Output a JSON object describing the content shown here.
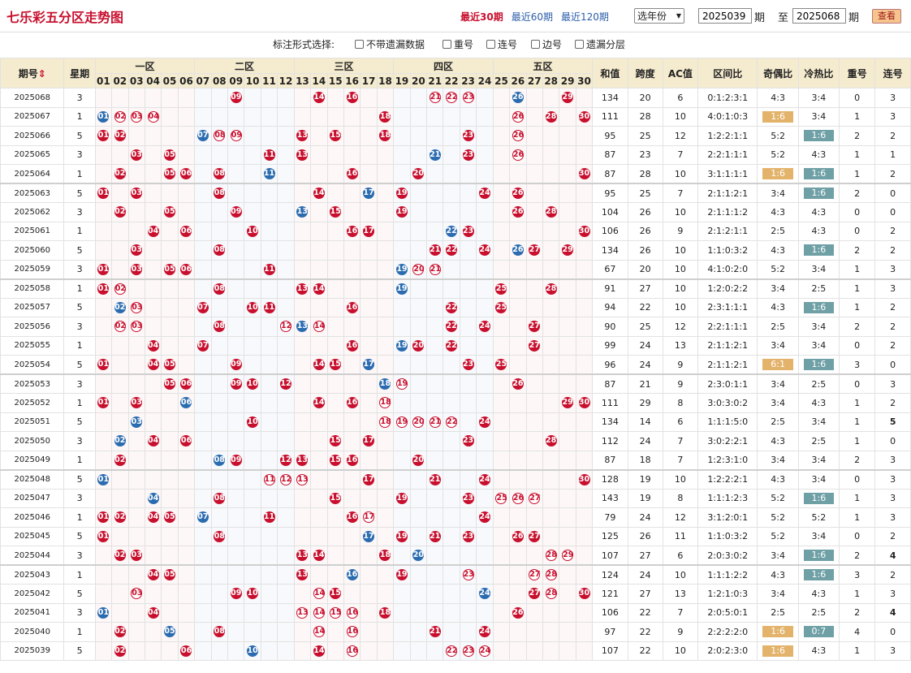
{
  "title": "七乐彩五分区走势图",
  "period_links": [
    {
      "label": "最近30期",
      "active": true
    },
    {
      "label": "最近60期",
      "active": false
    },
    {
      "label": "最近120期",
      "active": false
    }
  ],
  "year_select": "选年份",
  "range": {
    "from": "2025039",
    "to": "2025068",
    "issue_unit": "期",
    "to_label": "至"
  },
  "view_button": "查看",
  "annotation": {
    "label": "标注形式选择:",
    "options": [
      "不带遗漏数据",
      "重号",
      "连号",
      "边号",
      "遗漏分层"
    ]
  },
  "columns": {
    "issue": "期号",
    "weekday": "星期",
    "zones": [
      "一区",
      "二区",
      "三区",
      "四区",
      "五区"
    ],
    "numbers": [
      "01",
      "02",
      "03",
      "04",
      "05",
      "06",
      "07",
      "08",
      "09",
      "10",
      "11",
      "12",
      "13",
      "14",
      "15",
      "16",
      "17",
      "18",
      "19",
      "20",
      "21",
      "22",
      "23",
      "24",
      "25",
      "26",
      "27",
      "28",
      "29",
      "30"
    ],
    "stats": [
      "和值",
      "跨度",
      "AC值",
      "区间比",
      "奇偶比",
      "冷热比",
      "重号",
      "连号"
    ]
  },
  "rows": [
    {
      "issue": "2025068",
      "wd": "3",
      "balls": [
        9,
        14,
        16,
        21,
        22,
        23,
        26,
        29
      ],
      "blue": [
        26
      ],
      "ring": [
        21,
        22,
        23
      ],
      "sum": "134",
      "span": "20",
      "ac": "6",
      "zone": "0:1:2:3:1",
      "oe": "4:3",
      "ch": "3:4",
      "rep": "0",
      "con": "3",
      "oe_hl": "",
      "ch_hl": "",
      "rep_red": false,
      "con_green": false
    },
    {
      "issue": "2025067",
      "wd": "1",
      "balls": [
        1,
        2,
        3,
        4,
        18,
        26,
        28,
        30
      ],
      "blue": [
        1
      ],
      "ring": [
        2,
        3,
        4,
        26
      ],
      "sum": "111",
      "span": "28",
      "ac": "10",
      "zone": "4:0:1:0:3",
      "oe": "1:6",
      "ch": "3:4",
      "rep": "1",
      "con": "3",
      "oe_hl": "orange",
      "ch_hl": "",
      "rep_red": false,
      "con_green": false
    },
    {
      "issue": "2025066",
      "wd": "5",
      "balls": [
        1,
        2,
        7,
        8,
        9,
        13,
        15,
        18,
        23,
        26
      ],
      "blue": [
        7
      ],
      "ring": [
        8,
        9,
        26
      ],
      "sum": "95",
      "span": "25",
      "ac": "12",
      "zone": "1:2:2:1:1",
      "oe": "5:2",
      "ch": "1:6",
      "rep": "2",
      "con": "2",
      "oe_hl": "",
      "ch_hl": "teal",
      "rep_red": false,
      "con_green": false
    },
    {
      "issue": "2025065",
      "wd": "3",
      "balls": [
        3,
        5,
        11,
        13,
        21,
        23,
        26
      ],
      "blue": [
        21
      ],
      "ring": [
        26
      ],
      "sum": "87",
      "span": "23",
      "ac": "7",
      "zone": "2:2:1:1:1",
      "oe": "5:2",
      "ch": "4:3",
      "rep": "1",
      "con": "1",
      "oe_hl": "",
      "ch_hl": "",
      "rep_red": false,
      "con_green": false
    },
    {
      "issue": "2025064",
      "wd": "1",
      "balls": [
        2,
        5,
        6,
        8,
        11,
        16,
        20,
        30
      ],
      "blue": [
        11
      ],
      "ring": [],
      "sum": "87",
      "span": "28",
      "ac": "10",
      "zone": "3:1:1:1:1",
      "oe": "1:6",
      "ch": "1:6",
      "rep": "1",
      "con": "2",
      "oe_hl": "orange",
      "ch_hl": "teal",
      "rep_red": false,
      "con_green": false
    },
    {
      "issue": "2025063",
      "wd": "5",
      "balls": [
        1,
        3,
        8,
        14,
        17,
        19,
        24,
        26
      ],
      "blue": [
        17
      ],
      "ring": [],
      "sum": "95",
      "span": "25",
      "ac": "7",
      "zone": "2:1:1:2:1",
      "oe": "3:4",
      "ch": "1:6",
      "rep": "2",
      "con": "0",
      "oe_hl": "",
      "ch_hl": "teal",
      "rep_red": false,
      "con_green": false
    },
    {
      "issue": "2025062",
      "wd": "3",
      "balls": [
        2,
        5,
        9,
        13,
        15,
        19,
        26,
        28
      ],
      "blue": [
        13
      ],
      "ring": [],
      "sum": "104",
      "span": "26",
      "ac": "10",
      "zone": "2:1:1:1:2",
      "oe": "4:3",
      "ch": "4:3",
      "rep": "0",
      "con": "0",
      "oe_hl": "",
      "ch_hl": "",
      "rep_red": false,
      "con_green": false
    },
    {
      "issue": "2025061",
      "wd": "1",
      "balls": [
        4,
        6,
        10,
        16,
        17,
        22,
        23,
        30
      ],
      "blue": [
        22
      ],
      "ring": [],
      "sum": "106",
      "span": "26",
      "ac": "9",
      "zone": "2:1:2:1:1",
      "oe": "2:5",
      "ch": "4:3",
      "rep": "0",
      "con": "2",
      "oe_hl": "",
      "ch_hl": "",
      "rep_red": false,
      "con_green": false
    },
    {
      "issue": "2025060",
      "wd": "5",
      "balls": [
        3,
        8,
        21,
        22,
        24,
        26,
        27,
        29
      ],
      "blue": [
        26
      ],
      "ring": [],
      "sum": "134",
      "span": "26",
      "ac": "10",
      "zone": "1:1:0:3:2",
      "oe": "4:3",
      "ch": "1:6",
      "rep": "2",
      "con": "2",
      "oe_hl": "",
      "ch_hl": "teal",
      "rep_red": false,
      "con_green": false
    },
    {
      "issue": "2025059",
      "wd": "3",
      "balls": [
        1,
        3,
        5,
        6,
        11,
        19,
        20,
        21
      ],
      "blue": [
        19
      ],
      "ring": [
        20,
        21
      ],
      "sum": "67",
      "span": "20",
      "ac": "10",
      "zone": "4:1:0:2:0",
      "oe": "5:2",
      "ch": "3:4",
      "rep": "1",
      "con": "3",
      "oe_hl": "",
      "ch_hl": "",
      "rep_red": false,
      "con_green": false
    },
    {
      "issue": "2025058",
      "wd": "1",
      "balls": [
        1,
        2,
        8,
        13,
        14,
        19,
        25,
        28
      ],
      "blue": [
        19
      ],
      "ring": [
        2
      ],
      "sum": "91",
      "span": "27",
      "ac": "10",
      "zone": "1:2:0:2:2",
      "oe": "3:4",
      "ch": "2:5",
      "rep": "1",
      "con": "3",
      "oe_hl": "",
      "ch_hl": "",
      "rep_red": false,
      "con_green": false
    },
    {
      "issue": "2025057",
      "wd": "5",
      "balls": [
        2,
        3,
        7,
        10,
        11,
        16,
        22,
        25
      ],
      "blue": [
        2
      ],
      "ring": [
        3
      ],
      "sum": "94",
      "span": "22",
      "ac": "10",
      "zone": "2:3:1:1:1",
      "oe": "4:3",
      "ch": "1:6",
      "rep": "1",
      "con": "2",
      "oe_hl": "",
      "ch_hl": "teal",
      "rep_red": false,
      "con_green": false
    },
    {
      "issue": "2025056",
      "wd": "3",
      "balls": [
        2,
        3,
        8,
        12,
        13,
        14,
        22,
        24,
        27
      ],
      "blue": [
        13
      ],
      "ring": [
        2,
        3,
        12,
        14
      ],
      "sum": "90",
      "span": "25",
      "ac": "12",
      "zone": "2:2:1:1:1",
      "oe": "2:5",
      "ch": "3:4",
      "rep": "2",
      "con": "2",
      "oe_hl": "",
      "ch_hl": "",
      "rep_red": false,
      "con_green": false
    },
    {
      "issue": "2025055",
      "wd": "1",
      "balls": [
        4,
        7,
        16,
        19,
        20,
        22,
        27
      ],
      "blue": [
        19
      ],
      "ring": [
        3
      ],
      "sum": "99",
      "span": "24",
      "ac": "13",
      "zone": "2:1:1:2:1",
      "oe": "3:4",
      "ch": "3:4",
      "rep": "0",
      "con": "2",
      "oe_hl": "",
      "ch_hl": "",
      "rep_red": false,
      "con_green": false
    },
    {
      "issue": "2025054",
      "wd": "5",
      "balls": [
        1,
        4,
        5,
        9,
        14,
        15,
        17,
        23,
        25
      ],
      "blue": [
        17
      ],
      "ring": [
        19
      ],
      "sum": "96",
      "span": "24",
      "ac": "9",
      "zone": "2:1:1:2:1",
      "oe": "6:1",
      "ch": "1:6",
      "rep": "3",
      "con": "0",
      "oe_hl": "orange",
      "ch_hl": "teal",
      "rep_red": false,
      "con_green": false
    },
    {
      "issue": "2025053",
      "wd": "3",
      "balls": [
        5,
        6,
        9,
        10,
        12,
        18,
        19,
        26
      ],
      "blue": [
        18
      ],
      "ring": [
        19
      ],
      "sum": "87",
      "span": "21",
      "ac": "9",
      "zone": "2:3:0:1:1",
      "oe": "3:4",
      "ch": "2:5",
      "rep": "0",
      "con": "3",
      "oe_hl": "",
      "ch_hl": "",
      "rep_red": false,
      "con_green": false
    },
    {
      "issue": "2025052",
      "wd": "1",
      "balls": [
        1,
        3,
        6,
        14,
        16,
        18,
        29,
        30
      ],
      "blue": [
        6
      ],
      "ring": [
        18
      ],
      "sum": "111",
      "span": "29",
      "ac": "8",
      "zone": "3:0:3:0:2",
      "oe": "3:4",
      "ch": "4:3",
      "rep": "1",
      "con": "2",
      "oe_hl": "",
      "ch_hl": "",
      "rep_red": false,
      "con_green": false
    },
    {
      "issue": "2025051",
      "wd": "5",
      "balls": [
        3,
        10,
        18,
        19,
        20,
        21,
        22,
        24
      ],
      "blue": [
        3
      ],
      "ring": [
        18,
        19,
        20,
        21,
        22
      ],
      "sum": "134",
      "span": "14",
      "ac": "6",
      "zone": "1:1:1:5:0",
      "oe": "2:5",
      "ch": "3:4",
      "rep": "1",
      "con": "5",
      "oe_hl": "",
      "ch_hl": "",
      "rep_red": false,
      "con_green": true
    },
    {
      "issue": "2025050",
      "wd": "3",
      "balls": [
        2,
        4,
        6,
        15,
        17,
        23,
        28
      ],
      "blue": [
        2
      ],
      "ring": [],
      "sum": "112",
      "span": "24",
      "ac": "7",
      "zone": "3:0:2:2:1",
      "oe": "4:3",
      "ch": "2:5",
      "rep": "1",
      "con": "0",
      "oe_hl": "",
      "ch_hl": "",
      "rep_red": false,
      "con_green": false
    },
    {
      "issue": "2025049",
      "wd": "1",
      "balls": [
        2,
        8,
        9,
        12,
        13,
        15,
        16,
        20
      ],
      "blue": [
        8
      ],
      "ring": [],
      "sum": "87",
      "span": "18",
      "ac": "7",
      "zone": "1:2:3:1:0",
      "oe": "3:4",
      "ch": "3:4",
      "rep": "2",
      "con": "3",
      "oe_hl": "",
      "ch_hl": "",
      "rep_red": false,
      "con_green": false
    },
    {
      "issue": "2025048",
      "wd": "5",
      "balls": [
        1,
        11,
        12,
        13,
        17,
        21,
        24,
        30
      ],
      "blue": [
        1
      ],
      "ring": [
        11,
        12,
        13
      ],
      "sum": "128",
      "span": "19",
      "ac": "10",
      "zone": "1:2:2:2:1",
      "oe": "4:3",
      "ch": "3:4",
      "rep": "0",
      "con": "3",
      "oe_hl": "",
      "ch_hl": "",
      "rep_red": false,
      "con_green": false
    },
    {
      "issue": "2025047",
      "wd": "3",
      "balls": [
        4,
        8,
        15,
        19,
        23,
        25,
        26,
        27
      ],
      "blue": [
        4
      ],
      "ring": [
        25,
        26,
        27
      ],
      "sum": "143",
      "span": "19",
      "ac": "8",
      "zone": "1:1:1:2:3",
      "oe": "5:2",
      "ch": "1:6",
      "rep": "1",
      "con": "3",
      "oe_hl": "",
      "ch_hl": "teal",
      "rep_red": false,
      "con_green": false
    },
    {
      "issue": "2025046",
      "wd": "1",
      "balls": [
        1,
        2,
        4,
        5,
        7,
        11,
        16,
        17,
        24
      ],
      "blue": [
        7
      ],
      "ring": [
        17
      ],
      "sum": "79",
      "span": "24",
      "ac": "12",
      "zone": "3:1:2:0:1",
      "oe": "5:2",
      "ch": "5:2",
      "rep": "1",
      "con": "3",
      "oe_hl": "",
      "ch_hl": "",
      "rep_red": false,
      "con_green": false
    },
    {
      "issue": "2025045",
      "wd": "5",
      "balls": [
        1,
        8,
        17,
        19,
        21,
        23,
        26,
        27
      ],
      "blue": [
        17
      ],
      "ring": [],
      "sum": "125",
      "span": "26",
      "ac": "11",
      "zone": "1:1:0:3:2",
      "oe": "5:2",
      "ch": "3:4",
      "rep": "0",
      "con": "2",
      "oe_hl": "",
      "ch_hl": "",
      "rep_red": false,
      "con_green": false
    },
    {
      "issue": "2025044",
      "wd": "3",
      "balls": [
        2,
        3,
        13,
        14,
        18,
        20,
        28,
        29
      ],
      "blue": [
        20
      ],
      "ring": [
        28,
        29
      ],
      "sum": "107",
      "span": "27",
      "ac": "6",
      "zone": "2:0:3:0:2",
      "oe": "3:4",
      "ch": "1:6",
      "rep": "2",
      "con": "4",
      "oe_hl": "",
      "ch_hl": "teal",
      "rep_red": false,
      "con_green": true
    },
    {
      "issue": "2025043",
      "wd": "1",
      "balls": [
        4,
        5,
        13,
        16,
        19,
        23,
        27,
        28
      ],
      "blue": [
        16
      ],
      "ring": [
        23,
        27,
        28
      ],
      "sum": "124",
      "span": "24",
      "ac": "10",
      "zone": "1:1:1:2:2",
      "oe": "4:3",
      "ch": "1:6",
      "rep": "3",
      "con": "2",
      "oe_hl": "",
      "ch_hl": "teal",
      "rep_red": false,
      "con_green": false
    },
    {
      "issue": "2025042",
      "wd": "5",
      "balls": [
        3,
        9,
        10,
        14,
        15,
        24,
        27,
        28,
        30
      ],
      "blue": [
        24
      ],
      "ring": [
        3,
        14,
        28
      ],
      "sum": "121",
      "span": "27",
      "ac": "13",
      "zone": "1:2:1:0:3",
      "oe": "3:4",
      "ch": "4:3",
      "rep": "1",
      "con": "3",
      "oe_hl": "",
      "ch_hl": "",
      "rep_red": false,
      "con_green": false
    },
    {
      "issue": "2025041",
      "wd": "3",
      "balls": [
        1,
        4,
        13,
        14,
        15,
        16,
        18,
        26
      ],
      "blue": [
        1
      ],
      "ring": [
        13,
        14,
        15,
        16
      ],
      "sum": "106",
      "span": "22",
      "ac": "7",
      "zone": "2:0:5:0:1",
      "oe": "2:5",
      "ch": "2:5",
      "rep": "2",
      "con": "4",
      "oe_hl": "",
      "ch_hl": "",
      "rep_red": false,
      "con_green": true
    },
    {
      "issue": "2025040",
      "wd": "1",
      "balls": [
        2,
        5,
        8,
        14,
        16,
        21,
        24
      ],
      "blue": [
        5
      ],
      "ring": [
        14,
        16
      ],
      "sum": "97",
      "span": "22",
      "ac": "9",
      "zone": "2:2:2:2:0",
      "oe": "1:6",
      "ch": "0:7",
      "rep": "4",
      "con": "0",
      "oe_hl": "orange",
      "ch_hl": "teal",
      "rep_red": true,
      "con_green": false
    },
    {
      "issue": "2025039",
      "wd": "5",
      "balls": [
        2,
        6,
        10,
        14,
        16,
        22,
        23,
        24
      ],
      "blue": [
        10
      ],
      "ring": [
        16,
        22,
        23,
        24
      ],
      "sum": "107",
      "span": "22",
      "ac": "10",
      "zone": "2:0:2:3:0",
      "oe": "1:6",
      "ch": "4:3",
      "rep": "1",
      "con": "3",
      "oe_hl": "orange",
      "ch_hl": "",
      "rep_red": false,
      "con_green": false
    }
  ]
}
